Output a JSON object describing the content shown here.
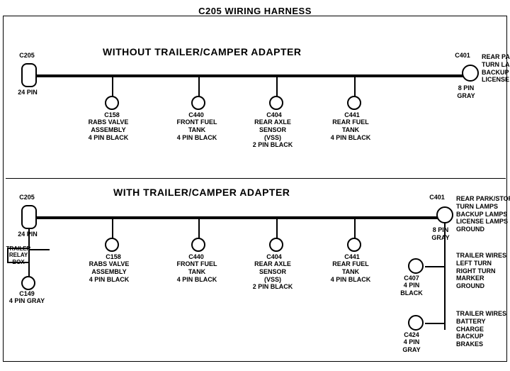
{
  "title": "C205 WIRING HARNESS",
  "top_section": {
    "title": "WITHOUT TRAILER/CAMPER ADAPTER",
    "left_connector": {
      "id": "C205",
      "label": "24 PIN"
    },
    "right_connector": {
      "id": "C401",
      "label": "8 PIN\nGRAY",
      "description": "REAR PARK/STOP\nTURN LAMPS\nBACKUP LAMPS\nLICENSE LAMPS"
    },
    "connectors": [
      {
        "id": "C158",
        "desc": "RABS VALVE\nASSEMBLY\n4 PIN BLACK"
      },
      {
        "id": "C440",
        "desc": "FRONT FUEL\nTANK\n4 PIN BLACK"
      },
      {
        "id": "C404",
        "desc": "REAR AXLE\nSENSOR\n(VSS)\n2 PIN BLACK"
      },
      {
        "id": "C441",
        "desc": "REAR FUEL\nTANK\n4 PIN BLACK"
      }
    ]
  },
  "bottom_section": {
    "title": "WITH TRAILER/CAMPER ADAPTER",
    "left_connector": {
      "id": "C205",
      "label": "24 PIN"
    },
    "right_connector": {
      "id": "C401",
      "label": "8 PIN\nGRAY",
      "description": "REAR PARK/STOP\nTURN LAMPS\nBACKUP LAMPS\nLICENSE LAMPS\nGROUND"
    },
    "extra_left": {
      "box_label": "TRAILER\nRELAY\nBOX",
      "id": "C149",
      "label": "4 PIN GRAY"
    },
    "connectors": [
      {
        "id": "C158",
        "desc": "RABS VALVE\nASSEMBLY\n4 PIN BLACK"
      },
      {
        "id": "C440",
        "desc": "FRONT FUEL\nTANK\n4 PIN BLACK"
      },
      {
        "id": "C404",
        "desc": "REAR AXLE\nSENSOR\n(VSS)\n2 PIN BLACK"
      },
      {
        "id": "C441",
        "desc": "REAR FUEL\nTANK\n4 PIN BLACK"
      }
    ],
    "right_extra": [
      {
        "id": "C407",
        "label": "4 PIN\nBLACK",
        "description": "TRAILER WIRES\nLEFT TURN\nRIGHT TURN\nMARKER\nGROUND"
      },
      {
        "id": "C424",
        "label": "4 PIN\nGRAY",
        "description": "TRAILER WIRES\nBATTERY CHARGE\nBACKUP\nBRAKES"
      }
    ]
  }
}
